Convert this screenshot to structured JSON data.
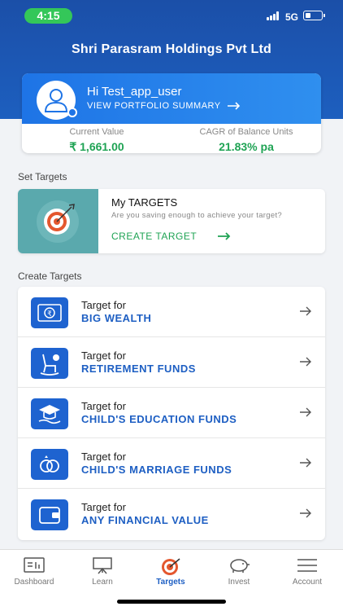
{
  "status": {
    "time": "4:15",
    "network": "5G"
  },
  "header": {
    "company": "Shri Parasram Holdings Pvt Ltd"
  },
  "profile": {
    "greeting": "Hi Test_app_user",
    "link": "VIEW PORTFOLIO SUMMARY",
    "current_value_label": "Current Value",
    "current_value": "₹ 1,661.00",
    "cagr_label": "CAGR of Balance Units",
    "cagr_value": "21.83% pa"
  },
  "set_targets": {
    "section_title": "Set Targets",
    "title": "My TARGETS",
    "subtitle": "Are you saving enough to achieve your target?",
    "action": "CREATE TARGET"
  },
  "create_targets": {
    "section_title": "Create Targets",
    "items": [
      {
        "small": "Target for",
        "big": "BIG WEALTH",
        "icon": "money-icon"
      },
      {
        "small": "Target for",
        "big": "RETIREMENT FUNDS",
        "icon": "rocking-chair-icon"
      },
      {
        "small": "Target for",
        "big": "CHILD'S EDUCATION FUNDS",
        "icon": "graduation-cap-icon"
      },
      {
        "small": "Target for",
        "big": "CHILD'S MARRIAGE FUNDS",
        "icon": "rings-icon"
      },
      {
        "small": "Target for",
        "big": "ANY FINANCIAL VALUE",
        "icon": "wallet-icon"
      }
    ]
  },
  "tabs": [
    {
      "label": "Dashboard",
      "icon": "dashboard-icon",
      "active": false
    },
    {
      "label": "Learn",
      "icon": "presentation-board-icon",
      "active": false
    },
    {
      "label": "Targets",
      "icon": "target-icon",
      "active": true
    },
    {
      "label": "Invest",
      "icon": "piggy-bank-icon",
      "active": false
    },
    {
      "label": "Account",
      "icon": "menu-icon",
      "active": false
    }
  ],
  "colors": {
    "brand_blue": "#1b4fa8",
    "accent_green": "#1fa354",
    "status_green": "#34c759"
  }
}
